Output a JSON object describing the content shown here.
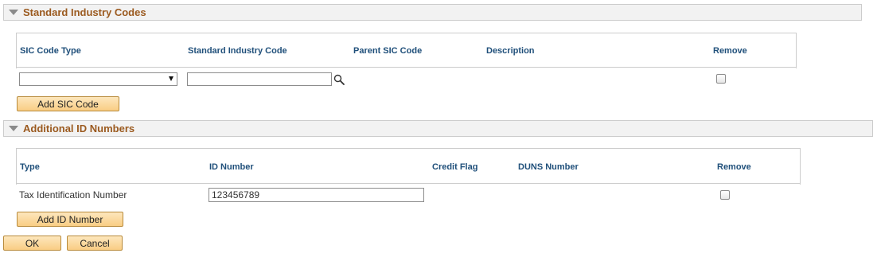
{
  "sic_section": {
    "title": "Standard Industry Codes",
    "columns": {
      "type": "SIC Code Type",
      "code": "Standard Industry Code",
      "parent": "Parent SIC Code",
      "description": "Description",
      "remove": "Remove"
    },
    "rows": [
      {
        "type": "",
        "code": "",
        "remove": false
      }
    ],
    "add_button": "Add SIC Code"
  },
  "id_section": {
    "title": "Additional ID Numbers",
    "columns": {
      "type": "Type",
      "id": "ID Number",
      "credit": "Credit Flag",
      "duns": "DUNS Number",
      "remove": "Remove"
    },
    "rows": [
      {
        "type": "Tax Identification Number",
        "id": "123456789",
        "remove": false
      }
    ],
    "add_button": "Add ID Number"
  },
  "footer": {
    "ok_label": "OK",
    "cancel_label": "Cancel"
  },
  "colors": {
    "section_title": "#9b5a1f",
    "column_header": "#1f4f7a",
    "button_top": "#fde7bd",
    "button_bottom": "#f9cd84"
  },
  "icons": {
    "lookup": "magnifier-icon",
    "collapse": "triangle-down-icon"
  }
}
